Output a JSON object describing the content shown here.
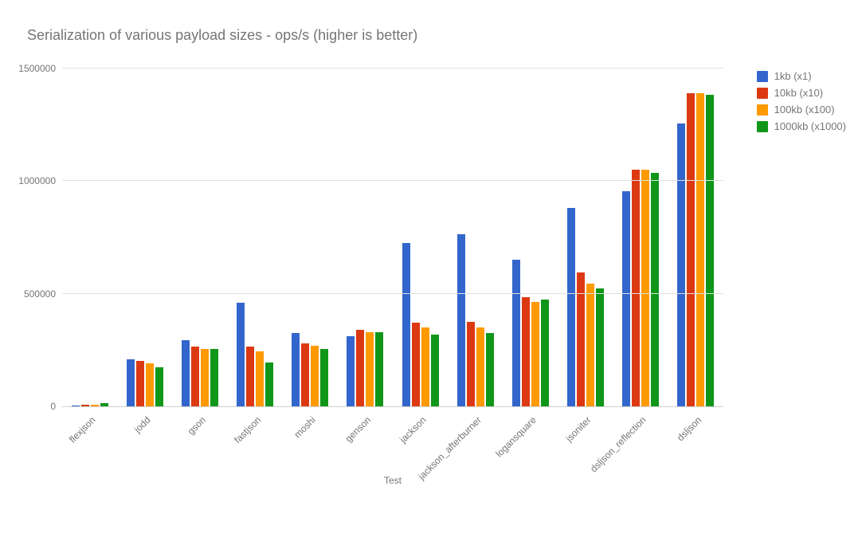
{
  "chart_data": {
    "type": "bar",
    "title": "Serialization of various payload sizes  - ops/s (higher is better)",
    "xlabel": "Test",
    "ylabel": "",
    "ylim": [
      0,
      1500000
    ],
    "yticks": [
      0,
      500000,
      1000000,
      1500000
    ],
    "categories": [
      "flexjson",
      "jodd",
      "gson",
      "fastjson",
      "moshi",
      "genson",
      "jackson",
      "jackson_afterburner",
      "logansquare",
      "jsoniter",
      "dsljson_reflection",
      "dsljson"
    ],
    "series": [
      {
        "name": "1kb (x1)",
        "color": "#3366cc",
        "values": [
          4000,
          210000,
          295000,
          460000,
          325000,
          310000,
          725000,
          765000,
          650000,
          880000,
          955000,
          1255000
        ]
      },
      {
        "name": "10kb (x10)",
        "color": "#dc3912",
        "values": [
          6000,
          200000,
          265000,
          265000,
          280000,
          340000,
          370000,
          375000,
          485000,
          595000,
          1050000,
          1390000
        ]
      },
      {
        "name": "100kb (x100)",
        "color": "#ff9900",
        "values": [
          8000,
          190000,
          255000,
          245000,
          270000,
          330000,
          350000,
          350000,
          465000,
          545000,
          1050000,
          1390000
        ]
      },
      {
        "name": "1000kb (x1000)",
        "color": "#109618",
        "values": [
          14000,
          175000,
          255000,
          195000,
          255000,
          330000,
          320000,
          325000,
          475000,
          525000,
          1035000,
          1385000
        ]
      }
    ]
  }
}
